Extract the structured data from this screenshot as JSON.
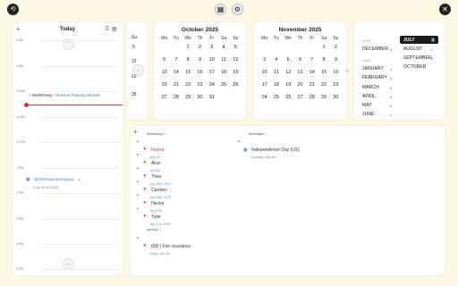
{
  "topbar": {
    "left_icon": "calendar-sync-icon",
    "center_icons": [
      "calendar-icon",
      "settings-icon"
    ],
    "right_icon": "close-icon"
  },
  "today_panel": {
    "title": "Today",
    "hours": [
      {
        "label": "8 AM"
      },
      {
        "label": "9 AM"
      },
      {
        "label": "10 AM"
      },
      {
        "label": "11 AM"
      },
      {
        "label": "12 PM"
      },
      {
        "label": "1 PM"
      },
      {
        "label": "2 PM"
      },
      {
        "label": "3 PM"
      },
      {
        "label": "4 PM"
      },
      {
        "label": "5 PM"
      }
    ],
    "event1": {
      "name": "WorkFlowy",
      "sep": " | ",
      "link": "Timeline Training Wheels"
    },
    "event2": {
      "name": "WorkFlowy.workspace",
      "sub": "1 Jul, 12:30-13:00"
    }
  },
  "prev_partial": {
    "head": "Su",
    "days": [
      "5",
      "12",
      "19",
      "26",
      "..."
    ]
  },
  "oct": {
    "title": "October 2025",
    "weekdays": [
      "Mo",
      "Tu",
      "We",
      "Th",
      "Fr",
      "Sa",
      "Su"
    ],
    "weeks": [
      [
        "",
        "",
        "1",
        "2",
        "3",
        "4",
        "5"
      ],
      [
        "6",
        "7",
        "8",
        "9",
        "10",
        "11",
        "12"
      ],
      [
        "13",
        "14",
        "15",
        "16",
        "17",
        "18",
        "19"
      ],
      [
        "20",
        "21",
        "22",
        "23",
        "24",
        "25",
        "26"
      ],
      [
        "27",
        "28",
        "29",
        "30",
        "31",
        "",
        ""
      ]
    ]
  },
  "nov": {
    "title": "November 2025",
    "weekdays": [
      "Mo",
      "Tu",
      "We",
      "Th",
      "Fr",
      "Sa",
      "Su"
    ],
    "weeks": [
      [
        "",
        "",
        "",
        "",
        "",
        "1",
        "2"
      ],
      [
        "3",
        "4",
        "5",
        "6",
        "7",
        "8",
        "9"
      ],
      [
        "10",
        "11",
        "12",
        "13",
        "14",
        "15",
        "16"
      ],
      [
        "17",
        "18",
        "19",
        "20",
        "21",
        "22",
        "23"
      ],
      [
        "24",
        "25",
        "26",
        "27",
        "28",
        "29",
        "30"
      ]
    ]
  },
  "month_picker": {
    "left": {
      "year1": "2025",
      "dec": "DECEMBER",
      "dec_badge": "6",
      "year2": "2026",
      "months": [
        {
          "name": "JANUARY",
          "badge": "3"
        },
        {
          "name": "FEBRUARY",
          "badge": "6"
        },
        {
          "name": "MARCH",
          "badge": "6"
        },
        {
          "name": "APRIL",
          "badge": "6"
        },
        {
          "name": "MAY",
          "badge": "6"
        },
        {
          "name": "JUNE",
          "badge": "6"
        }
      ]
    },
    "right": {
      "selected": "JULY",
      "selected_badge": "8",
      "months": [
        {
          "name": "AUGUST",
          "badge": "2"
        },
        {
          "name": "SEPTEMBER",
          "badge": "8"
        },
        {
          "name": "OCTOBER",
          "badge": ""
        }
      ]
    }
  },
  "lists": {
    "birthdays_tag": "#birthdays",
    "birthdays": [
      {
        "name": "Fiorna",
        "sub": "July 1st"
      },
      {
        "name": "Arun",
        "sub": "July 5th"
      },
      {
        "name": "Theo",
        "sub": "July 10th, 2024"
      },
      {
        "name": "Carmen",
        "sub": "July 16th, 1978"
      },
      {
        "name": "Hector",
        "sub": "July 27th"
      },
      {
        "name": "Tyler",
        "sub": "July 31st, 1997"
      }
    ],
    "holidays_tag": "#holidays",
    "holiday": {
      "name": "Independence Day (US)",
      "sub": "Thursday, July 4th"
    },
    "yearly_tag": "#yearly",
    "yearly": {
      "name": "600 | Fire insurance",
      "sub": "Yearly July 4th"
    }
  }
}
